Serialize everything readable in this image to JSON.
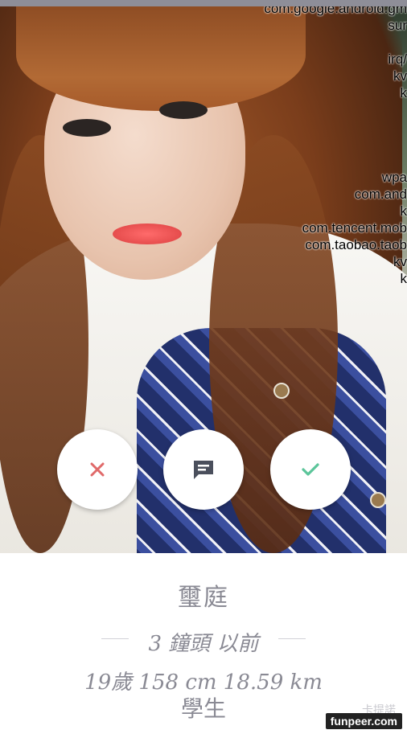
{
  "overlay_lines": [
    "com.google.android.gm",
    "sur",
    "",
    "irq/",
    "kv",
    "k",
    "",
    "",
    "",
    "",
    "wpa",
    "com.and",
    "k",
    "com.tencent.mob",
    "com.taobao.taob",
    "kv",
    "k"
  ],
  "actions": {
    "reject_icon": "close-icon",
    "message_icon": "chat-icon",
    "accept_icon": "check-icon"
  },
  "profile": {
    "name": "璽庭",
    "last_active": "3 鐘頭 以前",
    "stats": "19歲  158 cm  18.59 km",
    "occupation": "學生"
  },
  "watermark": {
    "ghost": "卡提諾",
    "brand": "funpeer.com"
  },
  "colors": {
    "reject": "#e06a6a",
    "message": "#4a4f5c",
    "accept": "#5cc59a",
    "text": "#8a8a94"
  }
}
